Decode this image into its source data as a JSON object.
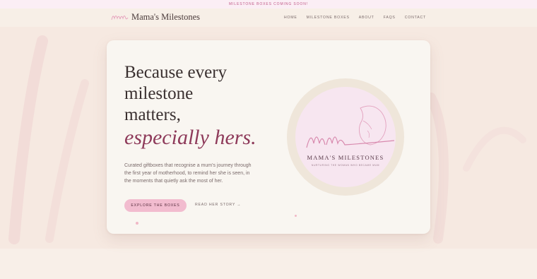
{
  "announcement": "MILESTONE BOXES COMING SOON!",
  "header": {
    "logo_text": "Mama's Milestones",
    "nav": [
      {
        "label": "HOME"
      },
      {
        "label": "MILESTONE BOXES"
      },
      {
        "label": "ABOUT"
      },
      {
        "label": "FAQS"
      },
      {
        "label": "CONTACT"
      }
    ]
  },
  "hero": {
    "heading_line1": "Because every",
    "heading_line2": "milestone",
    "heading_line3": "matters,",
    "heading_accent": "especially hers.",
    "paragraph": "Curated giftboxes that recognise a mum's journey through the first year of motherhood, to remind her she is seen, in the moments that quietly ask the most of her.",
    "primary_cta": "EXPLORE THE BOXES",
    "secondary_cta": "READ HER STORY →"
  },
  "brand_badge": {
    "title": "MAMA'S MILESTONES",
    "subtitle": "NURTURING THE WOMAN WHO BECAME MUM"
  },
  "colors": {
    "accent": "#8e3a5a",
    "button": "#f2bccf",
    "background": "#f8efe8"
  }
}
